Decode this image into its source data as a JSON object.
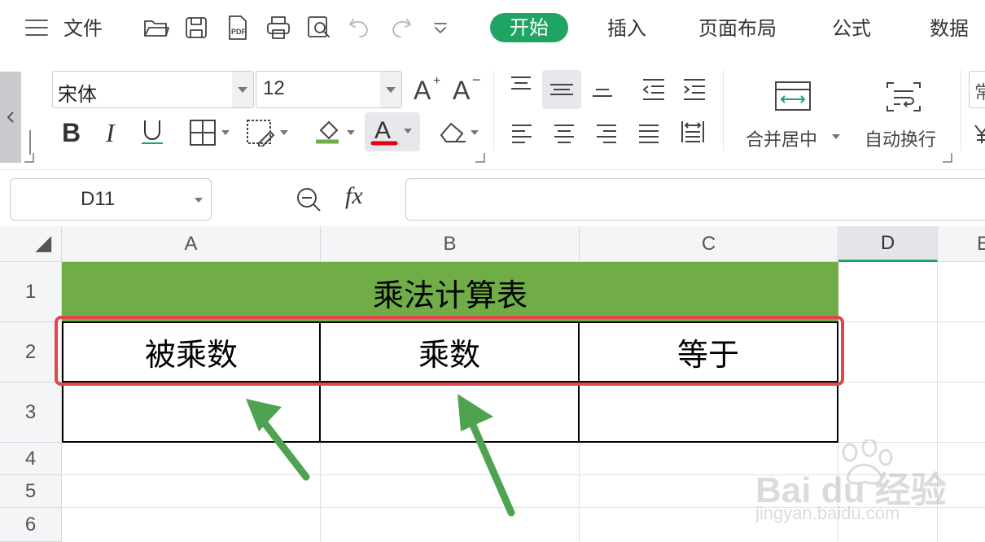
{
  "menubar": {
    "hamburger_label": "文件",
    "tabs": [
      "开始",
      "插入",
      "页面布局",
      "公式",
      "数据"
    ],
    "active_tab": "开始"
  },
  "ribbon": {
    "font_name": "宋体",
    "font_size": "12",
    "merge_label": "合并居中",
    "wrap_label": "自动换行",
    "number_format_partial": "常"
  },
  "formula_bar": {
    "cell_ref": "D11",
    "fx_label": "fx",
    "formula_value": ""
  },
  "grid": {
    "columns": [
      "A",
      "B",
      "C",
      "D",
      "E"
    ],
    "selected_column": "D",
    "rows": [
      "1",
      "2",
      "3",
      "4",
      "5",
      "6"
    ],
    "title": "乘法计算表",
    "header_cells": [
      "被乘数",
      "乘数",
      "等于"
    ]
  },
  "watermark": {
    "brand": "Bai du 经验",
    "url": "jingyan.baidu.com"
  },
  "colors": {
    "accent": "#1fa463",
    "title_fill": "#70ad47",
    "highlight_box": "#e0474c",
    "arrow": "#4fa350"
  }
}
